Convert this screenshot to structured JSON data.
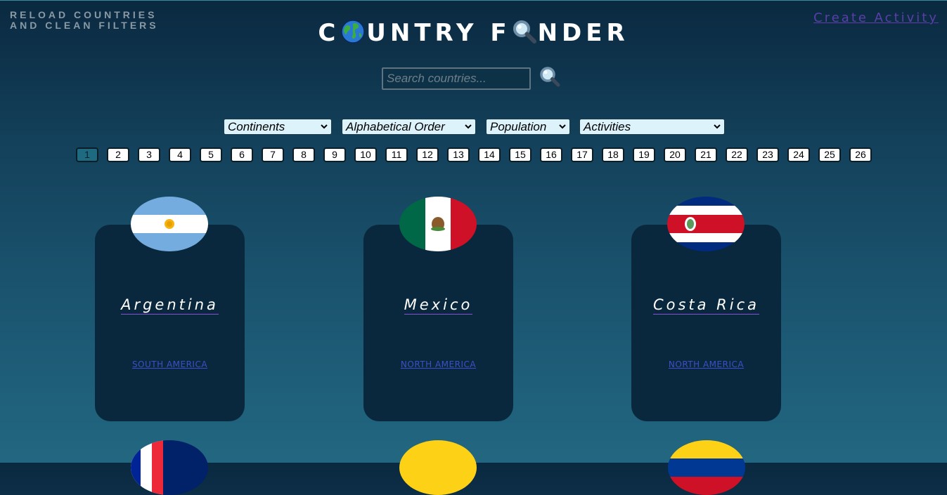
{
  "header": {
    "reload_line1": "RELOAD COUNTRIES",
    "reload_line2": "AND CLEAN FILTERS",
    "title_part1": "C",
    "title_part2": "UNTRY F",
    "title_part3": "NDER",
    "create_activity": "Create Activity"
  },
  "search": {
    "placeholder": "Search countries..."
  },
  "filters": {
    "continents": "Continents",
    "alphabetical": "Alphabetical Order",
    "population": "Population",
    "activities": "Activities"
  },
  "pagination": {
    "pages": [
      "1",
      "2",
      "3",
      "4",
      "5",
      "6",
      "7",
      "8",
      "9",
      "10",
      "11",
      "12",
      "13",
      "14",
      "15",
      "16",
      "17",
      "18",
      "19",
      "20",
      "21",
      "22",
      "23",
      "24",
      "25",
      "26"
    ],
    "current": "1"
  },
  "cards": [
    {
      "name": "Argentina",
      "continent": "SOUTH AMERICA"
    },
    {
      "name": "Mexico",
      "continent": "NORTH AMERICA"
    },
    {
      "name": "Costa Rica",
      "continent": "NORTH AMERICA"
    }
  ],
  "icons": {
    "globe": "globe-icon",
    "magnifier": "magnifier-icon",
    "search_button": "search-button-icon"
  }
}
